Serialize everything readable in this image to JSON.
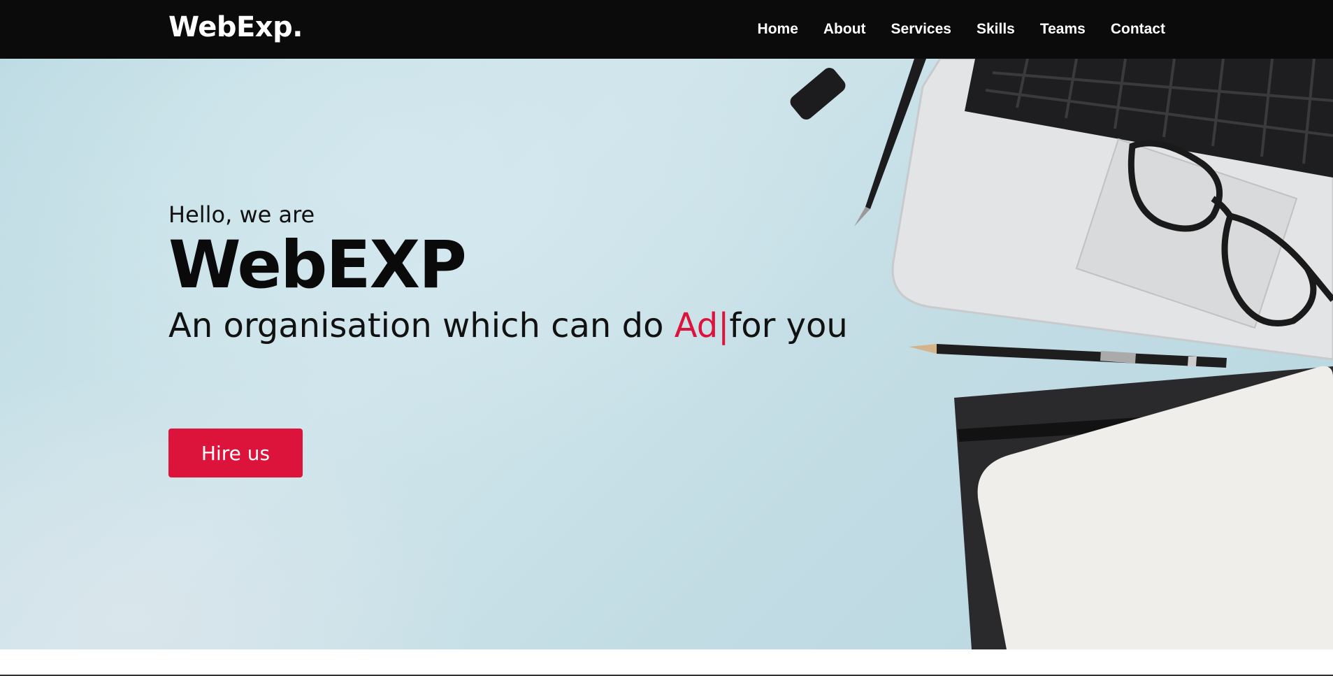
{
  "brand": {
    "logo": "WebExp."
  },
  "nav": {
    "items": [
      {
        "label": "Home"
      },
      {
        "label": "About"
      },
      {
        "label": "Services"
      },
      {
        "label": "Skills"
      },
      {
        "label": "Teams"
      },
      {
        "label": "Contact"
      }
    ]
  },
  "hero": {
    "greeting": "Hello, we are",
    "title": "WebEXP",
    "tagline_prefix": "An organisation which can do ",
    "typed_text": "Ad",
    "cursor": "|",
    "tagline_suffix": "for you",
    "cta_label": "Hire us"
  },
  "colors": {
    "navbar_bg": "#0b0b0b",
    "accent": "#dc143c",
    "hero_bg": "#c8e2e9"
  }
}
